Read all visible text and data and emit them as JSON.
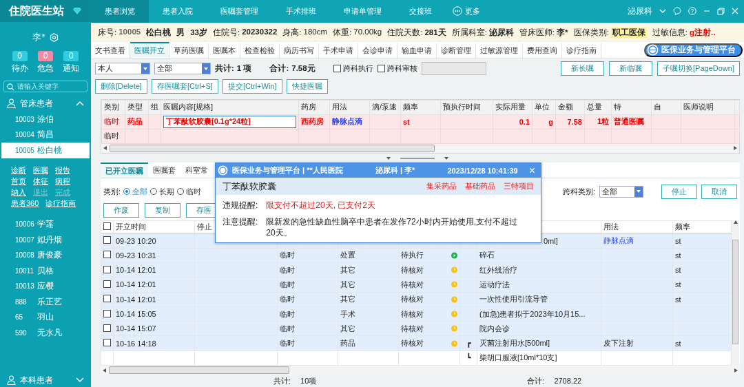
{
  "sidebar": {
    "title": "住院医生站",
    "user": "李*",
    "counters": [
      {
        "value": "0",
        "label": "待办",
        "kind": "normal"
      },
      {
        "value": "0",
        "label": "危急",
        "kind": "alert"
      },
      {
        "value": "0",
        "label": "通知",
        "kind": "normal"
      }
    ],
    "search": {
      "placeholder": "请输入关键字"
    },
    "sections": [
      {
        "label": "管床患者",
        "expanded": true,
        "patients": [
          {
            "id": "10003",
            "name": "涂伯",
            "selected": false
          },
          {
            "id": "10004",
            "name": "简昌",
            "selected": false
          },
          {
            "id": "10005",
            "name": "松白桃",
            "selected": true,
            "action_rows": [
              [
                {
                  "label": "诊断",
                  "disabled": false
                },
                {
                  "label": "医嘱",
                  "disabled": false
                },
                {
                  "label": "报告",
                  "disabled": false
                }
              ],
              [
                {
                  "label": "首页",
                  "disabled": false
                },
                {
                  "label": "体征",
                  "disabled": false
                },
                {
                  "label": "病程",
                  "disabled": false
                }
              ],
              [
                {
                  "label": "纳入",
                  "disabled": false
                },
                {
                  "label": "退出",
                  "disabled": true
                },
                {
                  "label": "完成",
                  "disabled": true
                }
              ],
              [
                {
                  "label": "患者360",
                  "disabled": false
                },
                {
                  "label": "诊疗指南",
                  "disabled": false
                }
              ]
            ]
          },
          {
            "id": "10006",
            "name": "学莲",
            "selected": false
          },
          {
            "id": "10007",
            "name": "姒丹烟",
            "selected": false
          },
          {
            "id": "10008",
            "name": "唐俊豪",
            "selected": false
          },
          {
            "id": "10011",
            "name": "贝格",
            "selected": false
          },
          {
            "id": "10013",
            "name": "应樱",
            "selected": false
          },
          {
            "id": "888",
            "name": "乐正艺",
            "selected": false
          },
          {
            "id": "65",
            "name": "羽山",
            "selected": false
          },
          {
            "id": "590",
            "name": "无水凡",
            "selected": false
          }
        ]
      },
      {
        "label": "本科患者",
        "expanded": false
      }
    ]
  },
  "nav": {
    "items": [
      {
        "label": "患者浏览",
        "selected": true
      },
      {
        "label": "患者入院",
        "selected": false
      },
      {
        "label": "医嘱套管理",
        "selected": false
      },
      {
        "label": "手术排班",
        "selected": false
      },
      {
        "label": "申请单管理",
        "selected": false
      },
      {
        "label": "交接班",
        "selected": false
      }
    ],
    "more": "更多",
    "department": "泌尿科"
  },
  "patient_info": [
    {
      "label": "床号:",
      "value": "10005",
      "kind": "muted"
    },
    {
      "value": "松白桃",
      "kind": "plain"
    },
    {
      "value": "男",
      "kind": "plain"
    },
    {
      "value": "33岁",
      "kind": "plain"
    },
    {
      "label": "住院号:",
      "value": "20230322",
      "kind": "plain"
    },
    {
      "label": "身高:",
      "value": "180cm",
      "kind": "normal"
    },
    {
      "label": "体重:",
      "value": "70.00kg",
      "kind": "normal"
    },
    {
      "label": "住院天数:",
      "value": "281天",
      "kind": "plain"
    },
    {
      "label": "所属科室:",
      "value": "泌尿科",
      "kind": "plain"
    },
    {
      "label": "管床医师:",
      "value": "李*",
      "kind": "plain"
    },
    {
      "label": "医保类别:",
      "value": "职工医保",
      "kind": "highlight"
    },
    {
      "label": "过敏信息:",
      "value": "g注射..",
      "kind": "alert"
    }
  ],
  "tabs": {
    "items": [
      {
        "label": "文书查看",
        "selected": false
      },
      {
        "label": "医嘱开立",
        "selected": true
      },
      {
        "label": "草药医嘱",
        "selected": false
      },
      {
        "label": "医嘱本",
        "selected": false
      },
      {
        "label": "检查检验",
        "selected": false
      },
      {
        "label": "病历书写",
        "selected": false
      },
      {
        "label": "手术申请",
        "selected": false
      },
      {
        "label": "会诊申请",
        "selected": false
      },
      {
        "label": "输血申请",
        "selected": false
      },
      {
        "label": "诊断管理",
        "selected": false
      },
      {
        "label": "过敏源管理",
        "selected": false
      },
      {
        "label": "费用查询",
        "selected": false
      },
      {
        "label": "诊疗指南",
        "selected": false
      }
    ],
    "platform_button": "医保业务与管理平台"
  },
  "toolbar": {
    "scope_select": "本人",
    "type_select": "全部",
    "count_label": "共计:",
    "count": "1 项",
    "sum_label": "合计:",
    "sum": "7.58元",
    "checks": [
      {
        "label": "跨科执行",
        "checked": false
      },
      {
        "label": "跨科审核",
        "checked": false
      }
    ],
    "buttons_right": [
      "新长嘱",
      "新临嘱",
      "子嘱切换[PageDown]"
    ],
    "buttons_left": [
      "删除[Delete]",
      "存医嘱套[Ctrl+S]",
      "提交[Ctrl+Win]",
      "快捷医嘱"
    ]
  },
  "order_table": {
    "columns": [
      "类别",
      "类型",
      "组",
      "医嘱内容[规格]",
      "药房",
      "用法",
      "滴/泵速",
      "频率",
      "预执行时间",
      "实际用量",
      "单位",
      "金额",
      "总量",
      "特",
      "自",
      "医师说明"
    ],
    "rows": [
      {
        "kind": "drug",
        "focused": true,
        "cells": [
          "临时",
          "药品",
          "",
          "丁苯酞软胶囊[0.1g*24粒]",
          "西药房",
          "静脉点滴",
          "",
          "st",
          "",
          "0.1",
          "g",
          "7.58",
          "1粒",
          "普通医嘱",
          "",
          ""
        ]
      },
      {
        "kind": "empty",
        "focused": false,
        "cells": [
          "临时",
          "",
          "",
          "",
          "",
          "",
          "",
          "",
          "",
          "",
          "",
          "",
          "",
          "",
          "",
          ""
        ]
      }
    ]
  },
  "lower_tabs": [
    {
      "label": "已开立医嘱",
      "selected": true
    },
    {
      "label": "医嘱套",
      "selected": false
    },
    {
      "label": "科室常",
      "selected": false
    }
  ],
  "filter": {
    "label": "类别:",
    "options": [
      {
        "label": "全部",
        "selected": true
      },
      {
        "label": "长期",
        "selected": false
      },
      {
        "label": "临时",
        "selected": false
      }
    ],
    "dept_label": "跨科类别:",
    "dept_select": "全部",
    "buttons": [
      "停止",
      "取消"
    ]
  },
  "action_buttons": [
    "作废",
    "复制",
    "存医"
  ],
  "given_table": {
    "header": {
      "checked": false,
      "time": "开立时间",
      "stop": "停止",
      "usage": "用法",
      "frequency": "频率"
    },
    "rows": [
      {
        "checked": false,
        "kind": "covered",
        "time": "09-23 10:20",
        "content": "0ml]",
        "usage": "静脉点滴",
        "usage_link": true,
        "frequency": "st",
        "selected": true
      },
      {
        "checked": false,
        "kind": "play",
        "time": "09-23 10:31",
        "type": "临时",
        "category": "处置",
        "status": "待执行",
        "content": "碎石",
        "frequency": "st",
        "selected": true
      },
      {
        "checked": false,
        "kind": "clock",
        "time": "10-14 12:01",
        "type": "临时",
        "category": "其它",
        "status": "待核对",
        "content": "红外线治疗",
        "frequency": "st",
        "selected": true
      },
      {
        "checked": false,
        "kind": "clock",
        "time": "10-14 12:01",
        "type": "临时",
        "category": "其它",
        "status": "待核对",
        "content": "运动疗法",
        "frequency": "st",
        "selected": true
      },
      {
        "checked": false,
        "kind": "clock",
        "time": "10-14 12:01",
        "type": "临时",
        "category": "其它",
        "status": "待核对",
        "content": "一次性使用引流导管",
        "frequency": "st",
        "selected": true
      },
      {
        "checked": false,
        "kind": "clock",
        "time": "10-14 15:05",
        "type": "临时",
        "category": "手术",
        "status": "待核对",
        "content": "(加急)患者拟于2023年10月15...",
        "selected": true
      },
      {
        "checked": false,
        "kind": "clock",
        "time": "10-14 15:07",
        "type": "临时",
        "category": "其它",
        "status": "待核对",
        "content": "院内会诊",
        "selected": true
      },
      {
        "checked": false,
        "kind": "clock",
        "time": "10-16 14:18",
        "type": "临时",
        "category": "药品",
        "status": "待核对",
        "group_mark": "┏",
        "content": "灭菌注射用水[500ml]",
        "usage": "皮下注射",
        "usage_link": false,
        "frequency": "st",
        "selected": true
      },
      {
        "kind": "child",
        "group_mark": "┗",
        "content": "柴胡口服液[10ml*10支]",
        "selected": false
      }
    ]
  },
  "footer": {
    "count_label": "共计:",
    "count": "10项",
    "sum_label": "合计:",
    "sum": "2708.22"
  },
  "popup": {
    "title": "医保业务与管理平台 | **人民医院",
    "dept": "泌尿科 | 李*",
    "time": "2023/12/28 10:41:39",
    "close": "×",
    "drug": "丁苯酞软胶囊",
    "tags": [
      "集采药品",
      "基础药品",
      "三特项目"
    ],
    "messages": [
      {
        "label": "违规提醒:",
        "text": "限支付不超过20天, 已支付2天",
        "kind": "violation"
      },
      {
        "label": "注意提醒:",
        "text": "限新发的急性缺血性脑卒中患者在发作72小时内开始使用,支付不超过20天。",
        "kind": "notice"
      }
    ]
  }
}
